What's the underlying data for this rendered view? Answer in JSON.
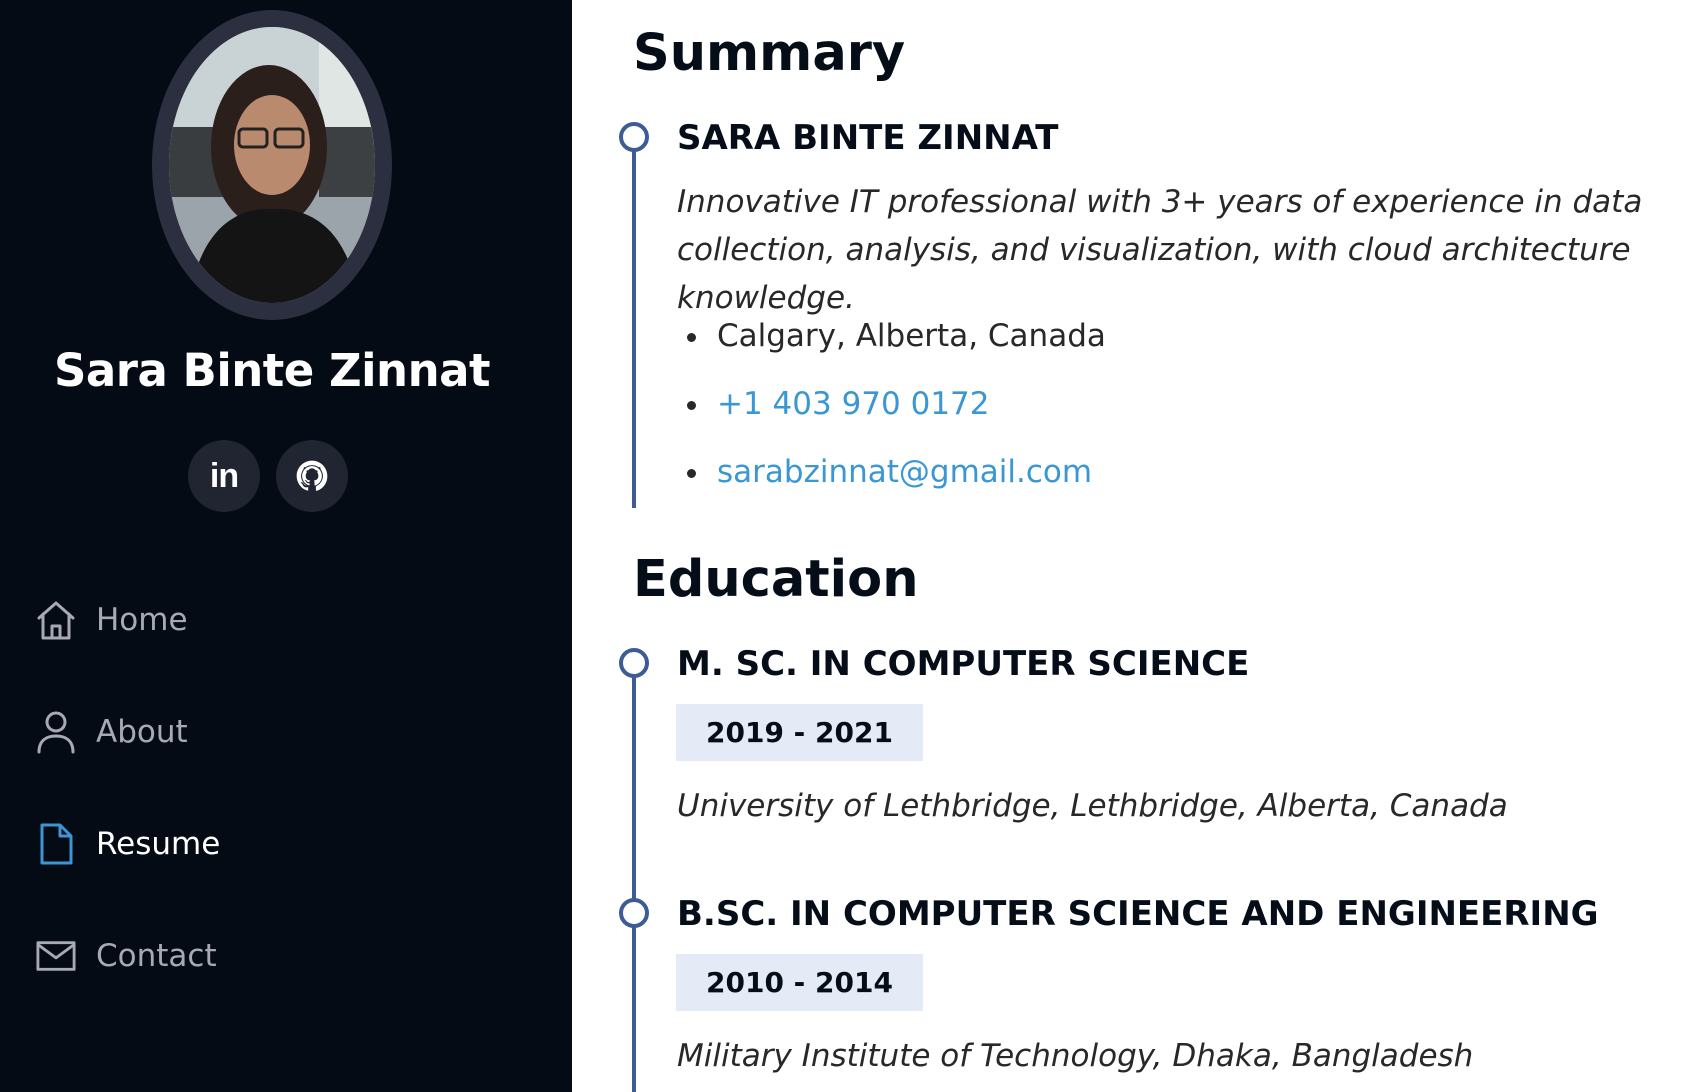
{
  "sidebar": {
    "profile_name": "Sara Binte Zinnat",
    "social": [
      {
        "label": "in",
        "icon": "linkedin-icon"
      },
      {
        "label": "",
        "icon": "github-icon"
      }
    ],
    "nav": [
      {
        "label": "Home",
        "icon": "home-icon",
        "active": false
      },
      {
        "label": "About",
        "icon": "user-icon",
        "active": false
      },
      {
        "label": "Resume",
        "icon": "file-icon",
        "active": true
      },
      {
        "label": "Contact",
        "icon": "envelope-icon",
        "active": false
      }
    ]
  },
  "main": {
    "summary": {
      "title": "Summary",
      "name": "SARA BINTE ZINNAT",
      "description": "Innovative IT professional with 3+ years of experience in data collection, analysis, and visualization, with cloud architecture knowledge.",
      "contact": {
        "location": "Calgary, Alberta, Canada",
        "phone": "+1 403 970 0172",
        "email": "sarabzinnat@gmail.com"
      }
    },
    "education": {
      "title": "Education",
      "items": [
        {
          "degree": "M. SC. IN COMPUTER SCIENCE",
          "years": "2019 - 2021",
          "institution": "University of Lethbridge, Lethbridge, Alberta, Canada"
        },
        {
          "degree": "B.SC. IN COMPUTER SCIENCE AND ENGINEERING",
          "years": "2010 - 2014",
          "institution": "Military Institute of Technology, Dhaka, Bangladesh"
        }
      ]
    }
  },
  "colors": {
    "sidebar_bg": "#040b14",
    "accent": "#3c5b97",
    "link": "#3a97d4",
    "active_icon": "#3a97d4",
    "badge_bg": "#e4ebf6"
  }
}
